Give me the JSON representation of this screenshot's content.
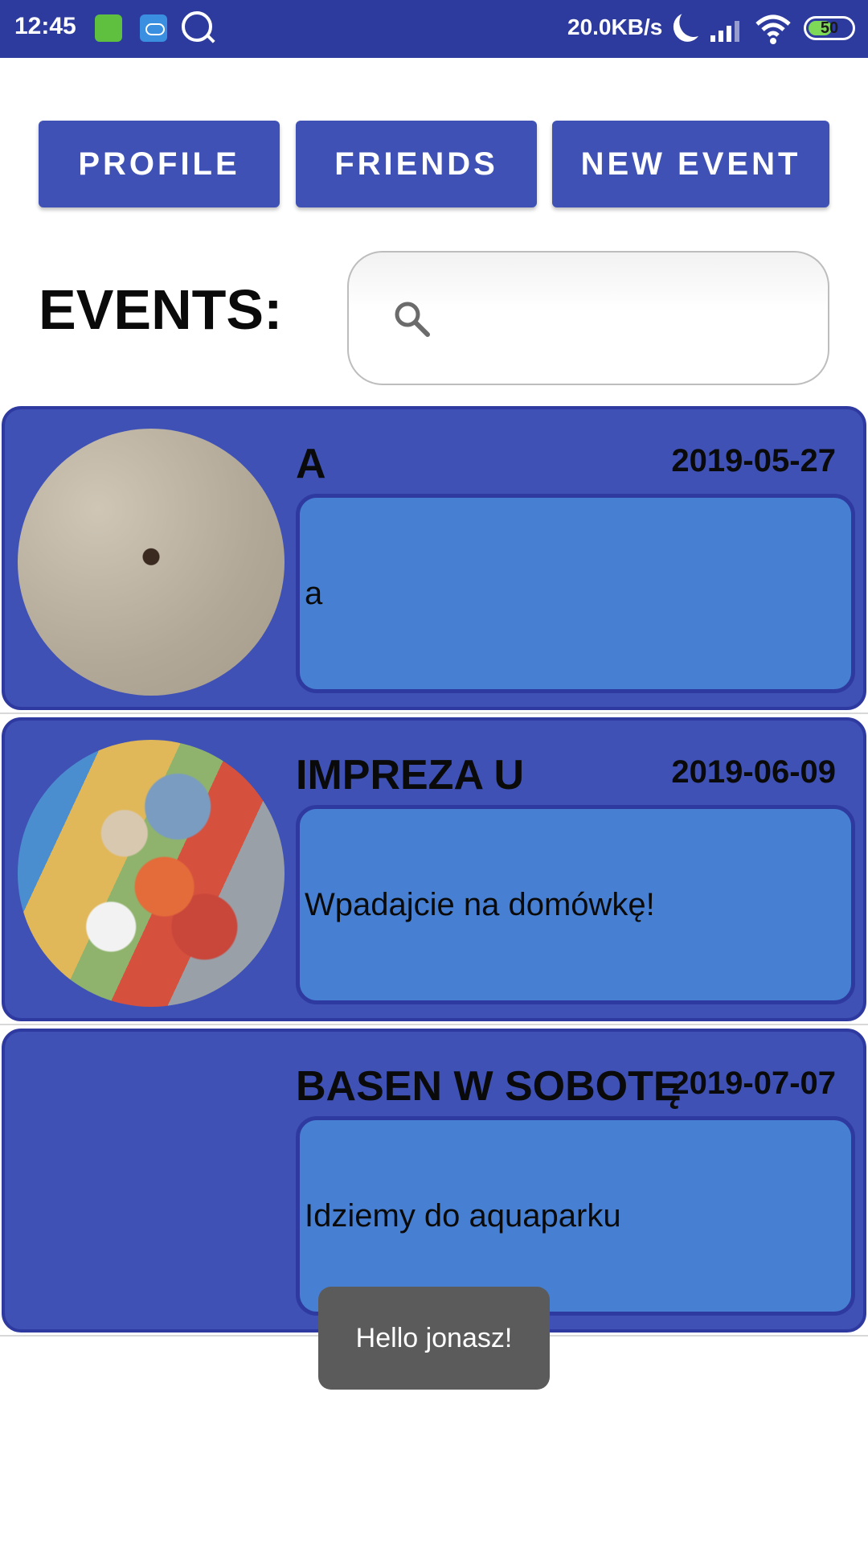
{
  "status_bar": {
    "time": "12:45",
    "net_speed": "20.0KB/s",
    "battery": "50",
    "icons": [
      "app-notification-icon",
      "cloud-icon",
      "search-icon",
      "moon-icon",
      "signal-icon",
      "wifi-icon",
      "battery-icon"
    ]
  },
  "nav": {
    "profile_label": "PROFILE",
    "friends_label": "FRIENDS",
    "new_event_label": "NEW EVENT"
  },
  "events_header": {
    "title": "EVENTS:",
    "search_placeholder": ""
  },
  "events": [
    {
      "title": "A",
      "date": "2019-05-27",
      "description": "a",
      "has_photo": true
    },
    {
      "title": "IMPREZA U",
      "date": "2019-06-09",
      "description": "Wpadajcie na domówkę!",
      "has_photo": true
    },
    {
      "title": "BASEN W SOBOTĘ",
      "date": "2019-07-07",
      "description": "Idziemy do aquaparku",
      "has_photo": false
    }
  ],
  "toast": {
    "message": "Hello jonasz!"
  },
  "colors": {
    "status_bar": "#2e3b9e",
    "primary": "#3f51b5",
    "card_border": "#2f3aa0",
    "description_box": "#4780d3",
    "toast": "#5b5b5b"
  }
}
